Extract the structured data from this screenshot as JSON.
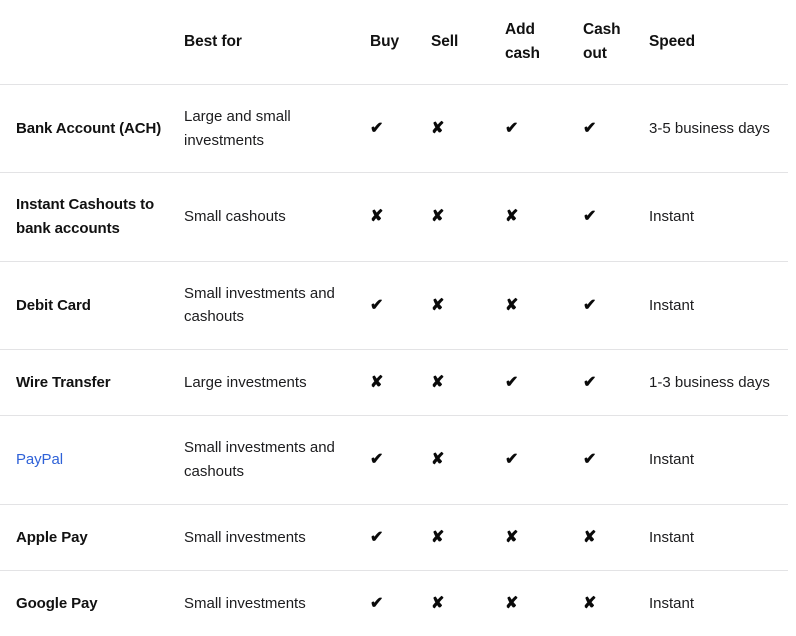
{
  "table": {
    "name": "payment-methods-comparison",
    "link_color": "#2f62d8",
    "text_color": "#111111",
    "border_color": "#e3e3e5",
    "glyphs": {
      "yes": "✔",
      "no": "✘"
    },
    "columns": [
      {
        "key": "method",
        "label": ""
      },
      {
        "key": "bestfor",
        "label": "Best for"
      },
      {
        "key": "buy",
        "label": "Buy"
      },
      {
        "key": "sell",
        "label": "Sell"
      },
      {
        "key": "addcash",
        "label": "Add cash"
      },
      {
        "key": "cashout",
        "label": "Cash out"
      },
      {
        "key": "speed",
        "label": "Speed"
      }
    ],
    "rows": [
      {
        "method": "Bank Account (ACH)",
        "is_link": false,
        "bestfor": "Large and small investments",
        "buy": "✔",
        "sell": "✘",
        "addcash": "✔",
        "cashout": "✔",
        "speed": "3-5 business days"
      },
      {
        "method": "Instant Cashouts to bank accounts",
        "is_link": false,
        "bestfor": "Small cashouts",
        "buy": "✘",
        "sell": "✘",
        "addcash": "✘",
        "cashout": "✔",
        "speed": "Instant"
      },
      {
        "method": "Debit Card",
        "is_link": false,
        "bestfor": "Small investments and cashouts",
        "buy": "✔",
        "sell": "✘",
        "addcash": "✘",
        "cashout": "✔",
        "speed": "Instant"
      },
      {
        "method": "Wire Transfer",
        "is_link": false,
        "bestfor": "Large investments",
        "buy": "✘",
        "sell": "✘",
        "addcash": "✔",
        "cashout": "✔",
        "speed": "1-3 business days"
      },
      {
        "method": "PayPal",
        "is_link": true,
        "bestfor": "Small investments and cashouts",
        "buy": "✔",
        "sell": "✘",
        "addcash": "✔",
        "cashout": "✔",
        "speed": "Instant"
      },
      {
        "method": "Apple Pay",
        "is_link": false,
        "bestfor": "Small investments",
        "buy": "✔",
        "sell": "✘",
        "addcash": "✘",
        "cashout": "✘",
        "speed": "Instant"
      },
      {
        "method": "Google Pay",
        "is_link": false,
        "bestfor": "Small investments",
        "buy": "✔",
        "sell": "✘",
        "addcash": "✘",
        "cashout": "✘",
        "speed": "Instant"
      }
    ]
  }
}
